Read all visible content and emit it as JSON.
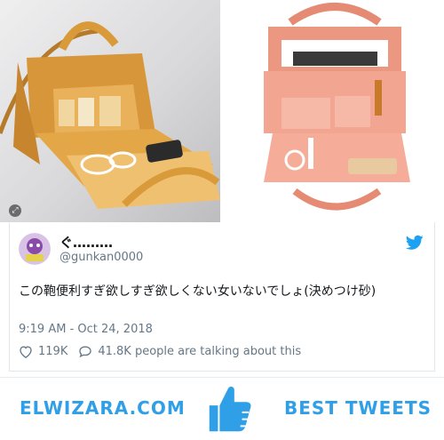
{
  "tweet": {
    "display_name": "ぐ………",
    "handle": "@gunkan0000",
    "text": "この鞄便利すぎ欲しすぎ欲しくない女いないでしょ(決めつけ砂)",
    "timestamp": "9:19 AM - Oct 24, 2018",
    "likes": "119K",
    "replies": "41.8K people are talking about this"
  },
  "icons": {
    "like": "heart-icon",
    "reply": "speech-bubble-icon",
    "brand": "twitter-bird-icon",
    "expand": "expand-icon"
  },
  "banner": {
    "site": "ELWIZARA.COM",
    "tagline": "BEST TWEETS"
  },
  "colors": {
    "twitter_blue": "#1da1f2",
    "banner_blue": "#2f9fe8",
    "text_gray": "#657786"
  }
}
